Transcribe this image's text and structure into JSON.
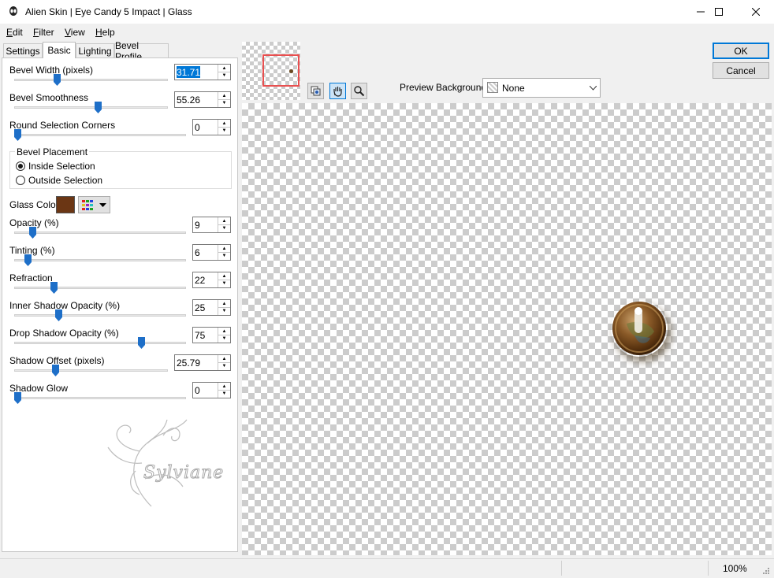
{
  "window": {
    "title": "Alien Skin | Eye Candy 5 Impact | Glass"
  },
  "menu": [
    {
      "label": "Edit",
      "key": "E",
      "rest": "dit"
    },
    {
      "label": "Filter",
      "key": "F",
      "rest": "ilter"
    },
    {
      "label": "View",
      "key": "V",
      "rest": "iew"
    },
    {
      "label": "Help",
      "key": "H",
      "rest": "elp"
    }
  ],
  "tabs": [
    "Settings",
    "Basic",
    "Lighting",
    "Bevel Profile"
  ],
  "active_tab": "Basic",
  "controls": {
    "bevel_width": {
      "label": "Bevel Width (pixels)",
      "value": "31.71",
      "level": 0.27
    },
    "bevel_smoothness": {
      "label": "Bevel Smoothness",
      "value": "55.26",
      "level": 0.55
    },
    "round_corners": {
      "label": "Round Selection Corners",
      "value": "0",
      "level": 0.0
    },
    "opacity": {
      "label": "Opacity (%)",
      "value": "9",
      "level": 0.09
    },
    "tinting": {
      "label": "Tinting (%)",
      "value": "6",
      "level": 0.06
    },
    "refraction": {
      "label": "Refraction",
      "value": "22",
      "level": 0.22
    },
    "inner_shadow": {
      "label": "Inner Shadow Opacity (%)",
      "value": "25",
      "level": 0.25
    },
    "drop_shadow": {
      "label": "Drop Shadow Opacity (%)",
      "value": "75",
      "level": 0.75
    },
    "shadow_offset": {
      "label": "Shadow Offset (pixels)",
      "value": "25.79",
      "level": 0.26
    },
    "shadow_glow": {
      "label": "Shadow Glow",
      "value": "0",
      "level": 0.0
    }
  },
  "bevel_placement": {
    "label": "Bevel Placement",
    "options": [
      "Inside Selection",
      "Outside Selection"
    ],
    "selected": "Inside Selection"
  },
  "glass_color": {
    "label": "Glass Color",
    "color": "#6b3614"
  },
  "watermark": {
    "text": "Sylviane"
  },
  "buttons": {
    "ok": "OK",
    "cancel": "Cancel"
  },
  "preview_background": {
    "label": "Preview Background:",
    "value": "None"
  },
  "status": {
    "zoom": "100%"
  },
  "colors": {
    "accent": "#0078d7",
    "thumb": "#1e6fc8",
    "glass": "#6b3614"
  }
}
